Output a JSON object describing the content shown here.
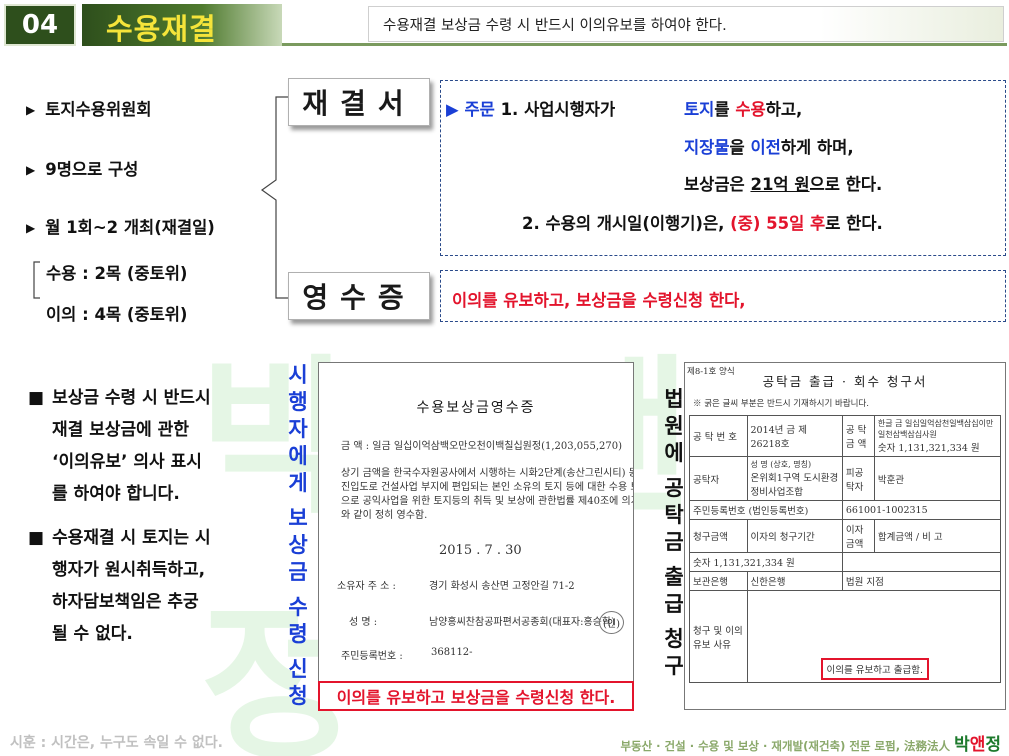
{
  "header": {
    "number": "04",
    "title": "수용재결",
    "subtitle": "수용재결 보상금 수령 시 반드시 이의유보를 하여야 한다."
  },
  "watermark": "박 앤 정",
  "left": {
    "bullets": [
      "토지수용위원회",
      "9명으로 구성",
      "월 1회~2 개최(재결일)"
    ],
    "sub_items": [
      "수용 : 2목 (중토위)",
      "이의 : 4목 (중토위)"
    ],
    "notes": [
      {
        "lines": [
          "보상금 수령 시 반드시",
          "재결 보상금에 관한",
          "‘이의유보’ 의사 표시",
          "를 하여야 합니다."
        ]
      },
      {
        "lines": [
          "수용재결 시 토지는 시",
          "행자가 원시취득하고,",
          "하자담보책임은 추궁",
          "될 수 없다."
        ]
      }
    ]
  },
  "decision": {
    "label": "재결서",
    "arrow": "▶",
    "juMun": "주문",
    "item1_prefix": "1. 사업시행자가",
    "line1": {
      "a": "토지",
      "b": "를 ",
      "c": "수용",
      "d": "하고,"
    },
    "line2": {
      "a": "지장물",
      "b": "을 ",
      "c": "이전",
      "d": "하게 하며,"
    },
    "line3": {
      "a": "보상금은 ",
      "b": "21억 원",
      "c": "으로 한다."
    },
    "item2": {
      "a": "2. 수용의 개시일(이행기)은, ",
      "b": "(중) 55일 후",
      "c": "로 한다."
    }
  },
  "receipt": {
    "label": "영수증",
    "text": "이의를 유보하고, 보상금을 수령신청 한다,"
  },
  "doc_left": {
    "side_label": [
      "시",
      "행",
      "자",
      "에",
      "게",
      "",
      "보",
      "상",
      "금",
      "",
      "수",
      "령",
      "",
      "신",
      "청"
    ],
    "title": "수용보상금영수증",
    "amount": "금 액 : 일금 일십이억삼백오만오천이백칠십원정(1,203,055,270)",
    "body": [
      "상기 금액을 한국수자원공사에서 시행하는 시화2단계(송산그린시티) 동서",
      "진입도로 건설사업 부지에 편입되는 본인 소유의 토지 등에 대한 수용 보상금",
      "으로 공익사업을 위한 토지등의 취득 및 보상에 관한법률 제40조에 의거 아래",
      "와 같이 정히 영수함."
    ],
    "date": "2015 . 7 . 30",
    "addr_label": "소유자 주 소 :",
    "addr": "경기 화성시 송산면 고정안길 71-2",
    "name_label": "성 명 :",
    "name": "남양홍씨찬참공파편서공종회(대표자:홍승학)",
    "id_label": "주민등록번호 :",
    "id": "368112-",
    "stamp": "(인)"
  },
  "caption": "이의를 유보하고 보상금을 수령신청 한다.",
  "doc_right": {
    "side_label": [
      "법",
      "원",
      "에",
      "",
      "공",
      "탁",
      "금",
      "",
      "출",
      "급",
      "",
      "청",
      "구"
    ],
    "form_no": "제8-1호 양식",
    "title": "공탁금 출급 · 회수 청구서",
    "note": "※ 굵은 글씨 부분은 반드시 기재하시기 바랍니다.",
    "cells": {
      "deposit_no_label": "공 탁 번 호",
      "deposit_no": "2014년 금 제 26218호",
      "amount_label": "공 탁 금 액",
      "amount_text": "한글 금 일십일억삼천일백삼십이만 일천삼백삼십사원",
      "amount_num": "숫자 1,131,321,334 원",
      "depositor": "공탁자",
      "name_label": "성 명 (상호, 명칭)",
      "company": "온위회1구역 도시환경정비사업조합",
      "claimant": "피공탁자",
      "claimant_name": "박훈관",
      "reg_label": "주민등록번호 (법인등록번호)",
      "reg_num": "661001-1002315",
      "req_amount": "청구금액",
      "interest": "이자의 청구기간",
      "interest_amt": "이자 금액",
      "total": "합계금액",
      "note2": "비 고",
      "bank": "보관은행",
      "bank_name": "신한은행",
      "court": "법원 지점",
      "reason": "청구 및 이의유보 사유",
      "reserve": "이의를 유보하고 출급함."
    }
  },
  "footer": {
    "left": "시훈 : 시간은, 누구도 속일 수 없다.",
    "right": "부동산 · 건설 · 수용 및 보상 · 재개발(재건축) 전문 로펌, 法務法人",
    "brand_a": "박",
    "brand_b": "앤",
    "brand_c": "정"
  }
}
